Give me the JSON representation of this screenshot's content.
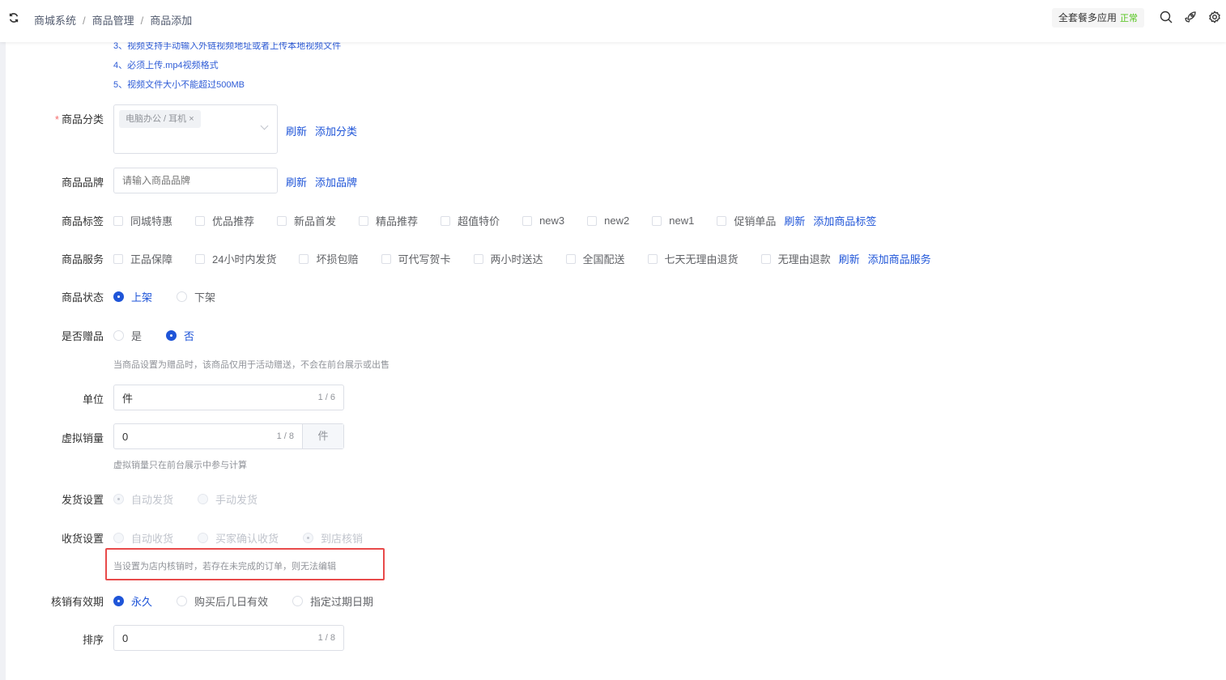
{
  "header": {
    "breadcrumb": [
      "商城系统",
      "商品管理",
      "商品添加"
    ],
    "plan": "全套餐多应用",
    "plan_status": "正常"
  },
  "video_tips": [
    "3、视频支持手动输入外链视频地址或者上传本地视频文件",
    "4、必须上传.mp4视频格式",
    "5、视频文件大小不能超过500MB"
  ],
  "category": {
    "label": "商品分类",
    "tag": "电脑办公 / 耳机",
    "refresh": "刷新",
    "add": "添加分类"
  },
  "brand": {
    "label": "商品品牌",
    "placeholder": "请输入商品品牌",
    "refresh": "刷新",
    "add": "添加品牌"
  },
  "tags": {
    "label": "商品标签",
    "options": [
      "同城特惠",
      "优品推荐",
      "新品首发",
      "精品推荐",
      "超值特价",
      "new3",
      "new2",
      "new1",
      "促销单品"
    ],
    "refresh": "刷新",
    "add": "添加商品标签"
  },
  "services": {
    "label": "商品服务",
    "options": [
      "正品保障",
      "24小时内发货",
      "坏损包赔",
      "可代写贺卡",
      "两小时送达",
      "全国配送",
      "七天无理由退货",
      "无理由退款"
    ],
    "refresh": "刷新",
    "add": "添加商品服务"
  },
  "status": {
    "label": "商品状态",
    "options": [
      "上架",
      "下架"
    ]
  },
  "gift": {
    "label": "是否赠品",
    "options": [
      "是",
      "否"
    ],
    "hint": "当商品设置为赠品时，该商品仅用于活动赠送，不会在前台展示或出售"
  },
  "unit": {
    "label": "单位",
    "value": "件",
    "count": "1 / 6"
  },
  "virtual_sales": {
    "label": "虚拟销量",
    "value": "0",
    "count": "1 / 8",
    "suffix": "件",
    "hint": "虚拟销量只在前台展示中参与计算"
  },
  "delivery": {
    "label": "发货设置",
    "options": [
      "自动发货",
      "手动发货"
    ]
  },
  "receipt": {
    "label": "收货设置",
    "options": [
      "自动收货",
      "买家确认收货",
      "到店核销"
    ],
    "hint": "当设置为店内核销时，若存在未完成的订单，则无法编辑"
  },
  "validity": {
    "label": "核销有效期",
    "options": [
      "永久",
      "购买后几日有效",
      "指定过期日期"
    ]
  },
  "sort": {
    "label": "排序",
    "value": "0",
    "count": "1 / 8"
  },
  "colors": {
    "primary": "#1f55d8",
    "highlight": "#e84a4a"
  }
}
